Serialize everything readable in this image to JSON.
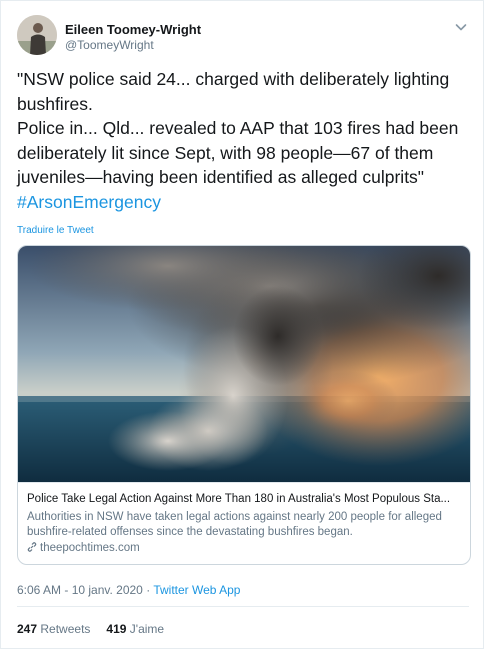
{
  "author": {
    "name": "Eileen Toomey-Wright",
    "handle": "@ToomeyWright"
  },
  "tweet": {
    "lines": [
      "\"NSW police said 24... charged with deliberately lighting",
      "bushfires.",
      "Police in... Qld... revealed to AAP that 103 fires had been",
      "deliberately lit since Sept, with 98 people—67 of them",
      "juveniles—having been identified as alleged culprits\""
    ],
    "hashtag": "#ArsonEmergency",
    "translate_label": "Traduire le Tweet"
  },
  "card": {
    "title": "Police Take Legal Action Against More Than 180 in Australia's Most Populous Sta...",
    "description": "Authorities in NSW have taken legal actions against nearly 200 people for alleged bushfire-related offenses since the devastating bushfires began.",
    "domain": "theepochtimes.com"
  },
  "meta": {
    "time_date": "6:06 AM - 10 janv. 2020 · ",
    "source": "Twitter Web App"
  },
  "stats": {
    "retweets_count": "247",
    "retweets_label": "Retweets",
    "likes_count": "419",
    "likes_label": "J'aime"
  },
  "colors": {
    "link": "#1b95e0",
    "secondary_text": "#657786",
    "primary_text": "#14171a",
    "border": "#e6ecf0"
  }
}
